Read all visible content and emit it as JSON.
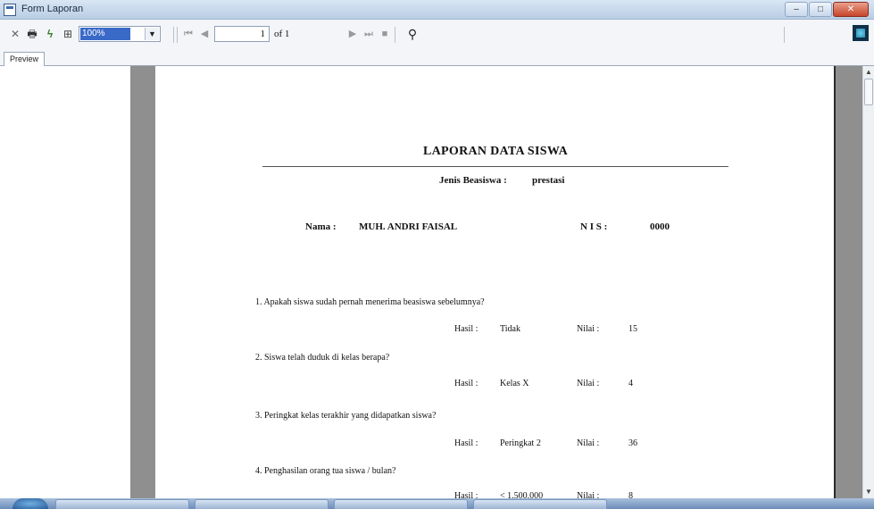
{
  "window": {
    "title": "Form Laporan",
    "min": "–",
    "max": "□",
    "close": "✕"
  },
  "toolbar": {
    "zoom_value": "100%",
    "page_current": "1",
    "page_of": "of 1"
  },
  "tabs": [
    {
      "label": "Preview"
    }
  ],
  "report": {
    "title": "LAPORAN DATA SISWA",
    "jenis_label": "Jenis Beasiswa :",
    "jenis_value": "prestasi",
    "nama_label": "Nama  :",
    "nama_value": "MUH. ANDRI FAISAL",
    "nis_label": "N I S  :",
    "nis_value": "0000",
    "questions": [
      {
        "text": "1. Apakah siswa sudah pernah menerima beasiswa sebelumnya?",
        "hasil_label": "Hasil :",
        "hasil": "Tidak",
        "nilai_label": "Nilai :",
        "nilai": "15"
      },
      {
        "text": "2. Siswa telah duduk di kelas berapa?",
        "hasil_label": "Hasil :",
        "hasil": "Kelas X",
        "nilai_label": "Nilai :",
        "nilai": "4"
      },
      {
        "text": "3. Peringkat kelas terakhir yang didapatkan siswa?",
        "hasil_label": "Hasil :",
        "hasil": "Peringkat 2",
        "nilai_label": "Nilai :",
        "nilai": "36"
      },
      {
        "text": "4. Penghasilan orang tua siswa / bulan?",
        "hasil_label": "Hasil :",
        "hasil": "< 1.500.000",
        "nilai_label": "Nilai :",
        "nilai": "8"
      }
    ]
  },
  "icons": [
    "window-app-icon",
    "close-report-icon",
    "print-icon",
    "export-icon",
    "group-tree-icon",
    "first-page-icon",
    "previous-page-icon",
    "next-page-icon",
    "last-page-icon",
    "stop-icon",
    "find-binoculars-icon",
    "crystal-reports-logo-icon"
  ]
}
